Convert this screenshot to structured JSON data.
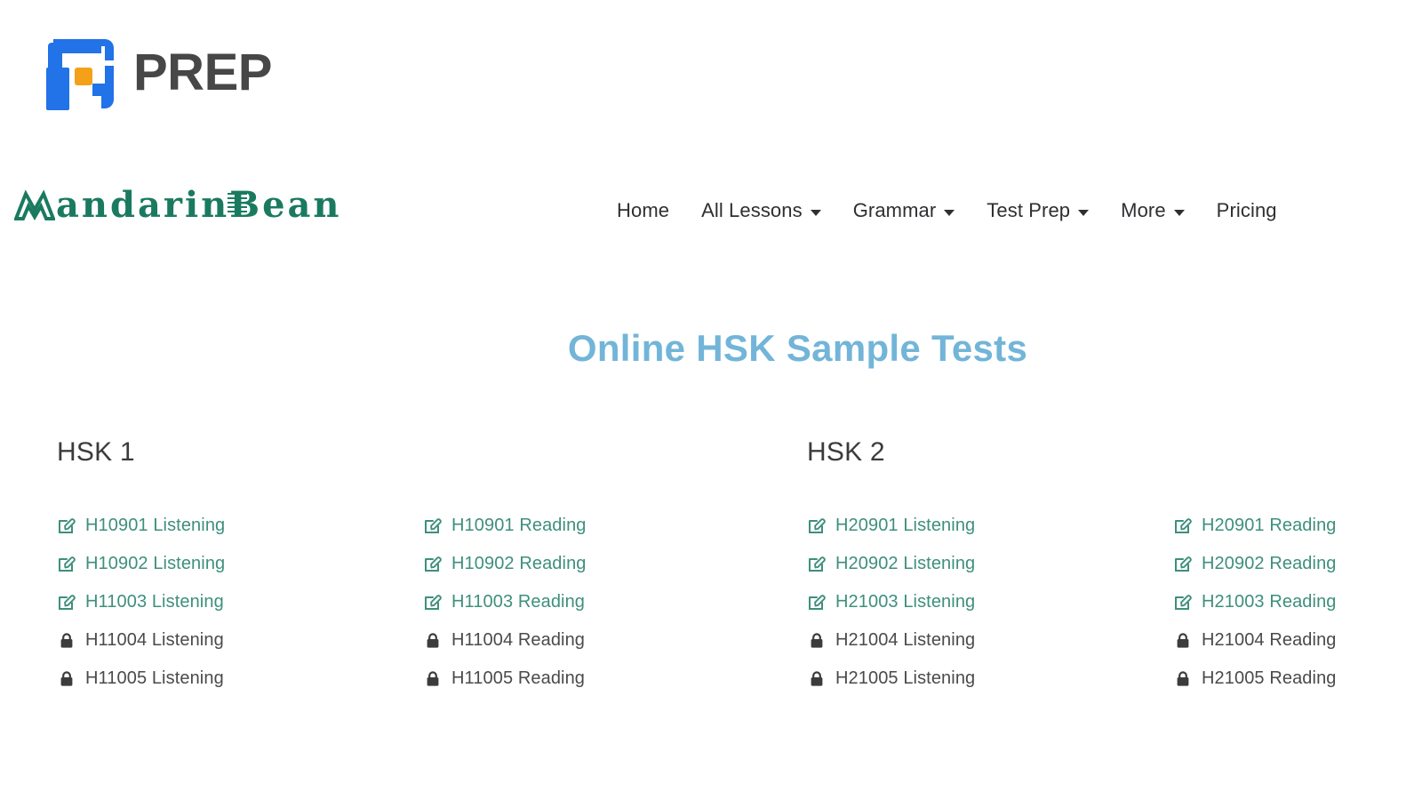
{
  "brand": {
    "logo_icon": "prep-logo-icon",
    "word": "PREP",
    "mark_color_primary": "#2272e8",
    "mark_color_accent": "#f5a019",
    "word_color": "#474747"
  },
  "site_header": {
    "logo": {
      "icon": "mandarinbean-mountain-icon",
      "text_part1": "M",
      "text_part2": "andarin",
      "text_part3": "B",
      "text_part4": "ean",
      "full_text": "MandarinBean",
      "color": "#1a7a60"
    },
    "nav": [
      {
        "label": "Home",
        "has_caret": false
      },
      {
        "label": "All Lessons",
        "has_caret": true
      },
      {
        "label": "Grammar",
        "has_caret": true
      },
      {
        "label": "Test Prep",
        "has_caret": true
      },
      {
        "label": "More",
        "has_caret": true
      },
      {
        "label": "Pricing",
        "has_caret": false
      }
    ]
  },
  "page": {
    "title": "Online HSK Sample Tests",
    "title_color": "#72b5d8"
  },
  "colors": {
    "link_available": "#3e8f7c",
    "link_locked": "#4a4a4c",
    "lock_icon": "#3c3c3c",
    "edit_icon": "#3e8f7c"
  },
  "groups": [
    {
      "title": "HSK 1",
      "columns": [
        {
          "skill": "Listening",
          "items": [
            {
              "label": "H10901 Listening",
              "state": "available",
              "icon": "edit-square-icon"
            },
            {
              "label": "H10902 Listening",
              "state": "available",
              "icon": "edit-square-icon"
            },
            {
              "label": "H11003 Listening",
              "state": "available",
              "icon": "edit-square-icon"
            },
            {
              "label": "H11004 Listening",
              "state": "locked",
              "icon": "lock-icon"
            },
            {
              "label": "H11005 Listening",
              "state": "locked",
              "icon": "lock-icon"
            }
          ]
        },
        {
          "skill": "Reading",
          "items": [
            {
              "label": "H10901 Reading",
              "state": "available",
              "icon": "edit-square-icon"
            },
            {
              "label": "H10902 Reading",
              "state": "available",
              "icon": "edit-square-icon"
            },
            {
              "label": "H11003 Reading",
              "state": "available",
              "icon": "edit-square-icon"
            },
            {
              "label": "H11004 Reading",
              "state": "locked",
              "icon": "lock-icon"
            },
            {
              "label": "H11005 Reading",
              "state": "locked",
              "icon": "lock-icon"
            }
          ]
        }
      ]
    },
    {
      "title": "HSK 2",
      "columns": [
        {
          "skill": "Listening",
          "items": [
            {
              "label": "H20901 Listening",
              "state": "available",
              "icon": "edit-square-icon"
            },
            {
              "label": "H20902 Listening",
              "state": "available",
              "icon": "edit-square-icon"
            },
            {
              "label": "H21003 Listening",
              "state": "available",
              "icon": "edit-square-icon"
            },
            {
              "label": "H21004 Listening",
              "state": "locked",
              "icon": "lock-icon"
            },
            {
              "label": "H21005 Listening",
              "state": "locked",
              "icon": "lock-icon"
            }
          ]
        },
        {
          "skill": "Reading",
          "items": [
            {
              "label": "H20901 Reading",
              "state": "available",
              "icon": "edit-square-icon"
            },
            {
              "label": "H20902 Reading",
              "state": "available",
              "icon": "edit-square-icon"
            },
            {
              "label": "H21003 Reading",
              "state": "available",
              "icon": "edit-square-icon"
            },
            {
              "label": "H21004 Reading",
              "state": "locked",
              "icon": "lock-icon"
            },
            {
              "label": "H21005 Reading",
              "state": "locked",
              "icon": "lock-icon"
            }
          ]
        }
      ]
    }
  ]
}
